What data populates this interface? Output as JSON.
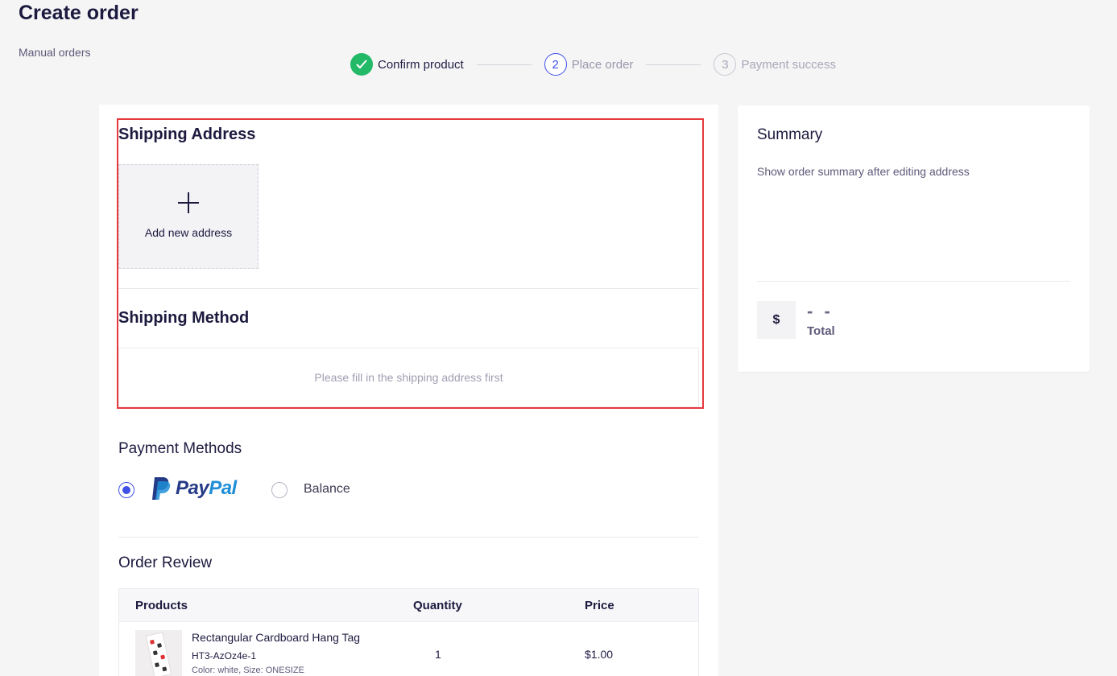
{
  "page": {
    "title": "Create order",
    "breadcrumb": "Manual orders"
  },
  "steps": [
    {
      "number": "1",
      "label": "Confirm product",
      "state": "done"
    },
    {
      "number": "2",
      "label": "Place order",
      "state": "active"
    },
    {
      "number": "3",
      "label": "Payment success",
      "state": "wait"
    }
  ],
  "shipping_address": {
    "title": "Shipping Address",
    "add_label": "Add new address"
  },
  "shipping_method": {
    "title": "Shipping Method",
    "empty_text": "Please fill in the shipping address first"
  },
  "payment": {
    "title": "Payment Methods",
    "options": [
      {
        "id": "paypal",
        "label_pay": "Pay",
        "label_pal": "Pal",
        "checked": true
      },
      {
        "id": "balance",
        "label": "Balance",
        "checked": false
      }
    ]
  },
  "order_review": {
    "title": "Order Review",
    "columns": {
      "products": "Products",
      "quantity": "Quantity",
      "price": "Price"
    },
    "rows": [
      {
        "name": "Rectangular Cardboard Hang Tag",
        "sku": "HT3-AzOz4e-1",
        "variant": "Color: white, Size: ONESIZE",
        "quantity": "1",
        "price": "$1.00"
      }
    ]
  },
  "summary": {
    "title": "Summary",
    "note": "Show order summary after editing address",
    "currency": "$",
    "total_value": "- -",
    "total_label": "Total"
  },
  "colors": {
    "accent": "#3f51e8",
    "success": "#22b967",
    "highlight": "#e5393d",
    "paypal_dark": "#243a86",
    "paypal_light": "#1f8ed6"
  }
}
